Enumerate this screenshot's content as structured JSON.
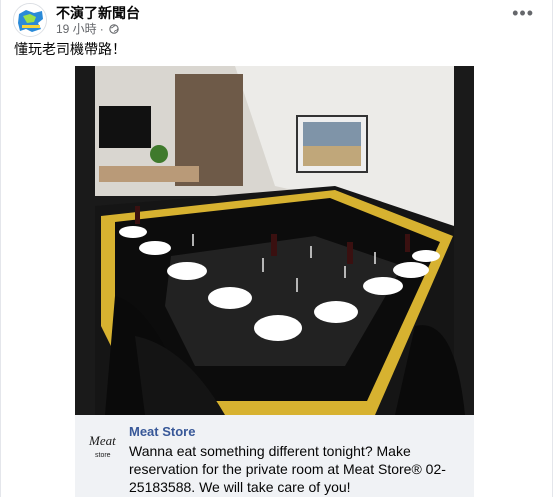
{
  "post": {
    "page_name": "不演了新聞台",
    "time": "19 小時",
    "dot": "·",
    "privacy_icon": "globe-icon",
    "more_icon": "more-icon",
    "more_label": "•••",
    "text": "懂玩老司機帶路！"
  },
  "photo": {
    "description_icon": "photo-image"
  },
  "link_preview": {
    "logo_top": "Meat",
    "logo_bottom": "store",
    "title": "Meat Store",
    "body": "Wanna eat something different tonight? Make reservation for the private room at Meat Store® 02-25183588. We will take care of you!"
  }
}
